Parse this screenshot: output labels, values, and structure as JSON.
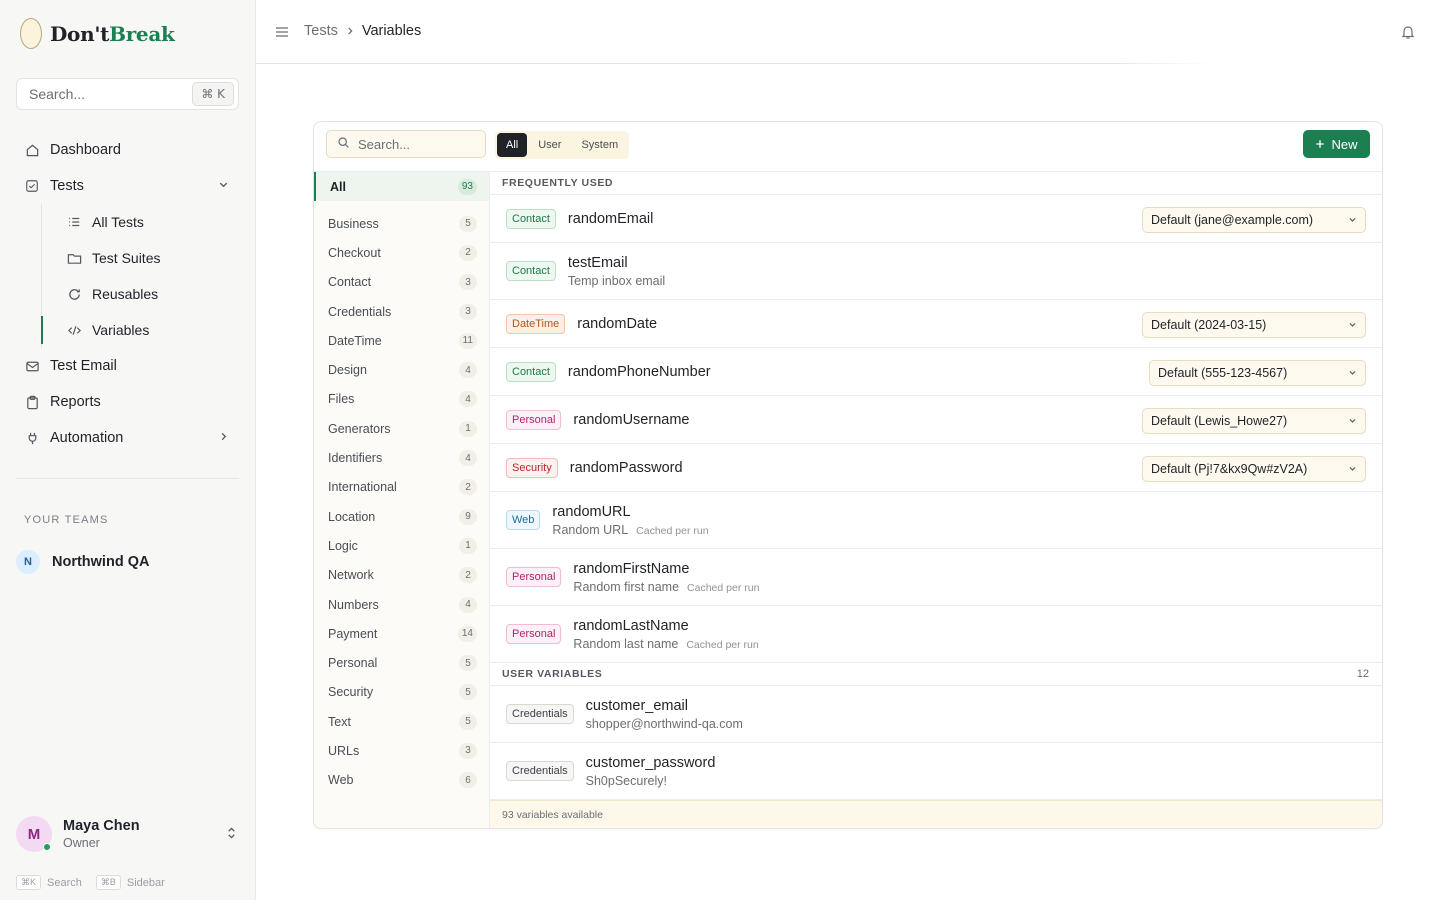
{
  "brand": {
    "name_prefix": "Don't",
    "name_accent": "Break"
  },
  "sidebar": {
    "search_placeholder": "Search...",
    "search_shortcut": "⌘ K",
    "nav": {
      "dashboard": "Dashboard",
      "tests": "Tests",
      "sub": {
        "all_tests": "All Tests",
        "test_suites": "Test Suites",
        "reusables": "Reusables",
        "variables": "Variables"
      },
      "test_email": "Test Email",
      "reports": "Reports",
      "automation": "Automation"
    },
    "teams_label": "YOUR TEAMS",
    "team": {
      "initial": "N",
      "name": "Northwind QA"
    },
    "user": {
      "initial": "M",
      "name": "Maya Chen",
      "role": "Owner"
    },
    "shortcuts": {
      "search_key": "⌘K",
      "search_label": "Search",
      "sidebar_key": "⌘B",
      "sidebar_label": "Sidebar"
    }
  },
  "header": {
    "breadcrumb_parent": "Tests",
    "breadcrumb_current": "Variables"
  },
  "panel": {
    "search_placeholder": "Search...",
    "filters": {
      "all": "All",
      "user": "User",
      "system": "System"
    },
    "new_label": "New",
    "category_all": {
      "label": "All",
      "count": "93"
    },
    "categories": [
      {
        "label": "Business",
        "count": "5"
      },
      {
        "label": "Checkout",
        "count": "2"
      },
      {
        "label": "Contact",
        "count": "3"
      },
      {
        "label": "Credentials",
        "count": "3"
      },
      {
        "label": "DateTime",
        "count": "11"
      },
      {
        "label": "Design",
        "count": "4"
      },
      {
        "label": "Files",
        "count": "4"
      },
      {
        "label": "Generators",
        "count": "1"
      },
      {
        "label": "Identifiers",
        "count": "4"
      },
      {
        "label": "International",
        "count": "2"
      },
      {
        "label": "Location",
        "count": "9"
      },
      {
        "label": "Logic",
        "count": "1"
      },
      {
        "label": "Network",
        "count": "2"
      },
      {
        "label": "Numbers",
        "count": "4"
      },
      {
        "label": "Payment",
        "count": "14"
      },
      {
        "label": "Personal",
        "count": "5"
      },
      {
        "label": "Security",
        "count": "5"
      },
      {
        "label": "Text",
        "count": "5"
      },
      {
        "label": "URLs",
        "count": "3"
      },
      {
        "label": "Web",
        "count": "6"
      }
    ],
    "frequent_label": "FREQUENTLY USED",
    "frequent": [
      {
        "tag": "Contact",
        "name": "randomEmail",
        "select": "Default (jane@example.com)"
      },
      {
        "tag": "Contact",
        "name": "testEmail",
        "desc": "Temp inbox email"
      },
      {
        "tag": "DateTime",
        "name": "randomDate",
        "select": "Default (2024-03-15)"
      },
      {
        "tag": "Contact",
        "name": "randomPhoneNumber",
        "select": "Default (555-123-4567)"
      },
      {
        "tag": "Personal",
        "name": "randomUsername",
        "select": "Default (Lewis_Howe27)"
      },
      {
        "tag": "Security",
        "name": "randomPassword",
        "select": "Default (Pj!7&kx9Qw#zV2A)"
      },
      {
        "tag": "Web",
        "name": "randomURL",
        "desc": "Random URL",
        "note": "Cached per run"
      },
      {
        "tag": "Personal",
        "name": "randomFirstName",
        "desc": "Random first name",
        "note": "Cached per run"
      },
      {
        "tag": "Personal",
        "name": "randomLastName",
        "desc": "Random last name",
        "note": "Cached per run"
      }
    ],
    "user_vars_label": "USER VARIABLES",
    "user_vars_count": "12",
    "user_vars": [
      {
        "tag": "Credentials",
        "name": "customer_email",
        "desc": "shopper@northwind-qa.com"
      },
      {
        "tag": "Credentials",
        "name": "customer_password",
        "desc": "Sh0pSecurely!"
      }
    ],
    "footer": "93 variables available"
  }
}
